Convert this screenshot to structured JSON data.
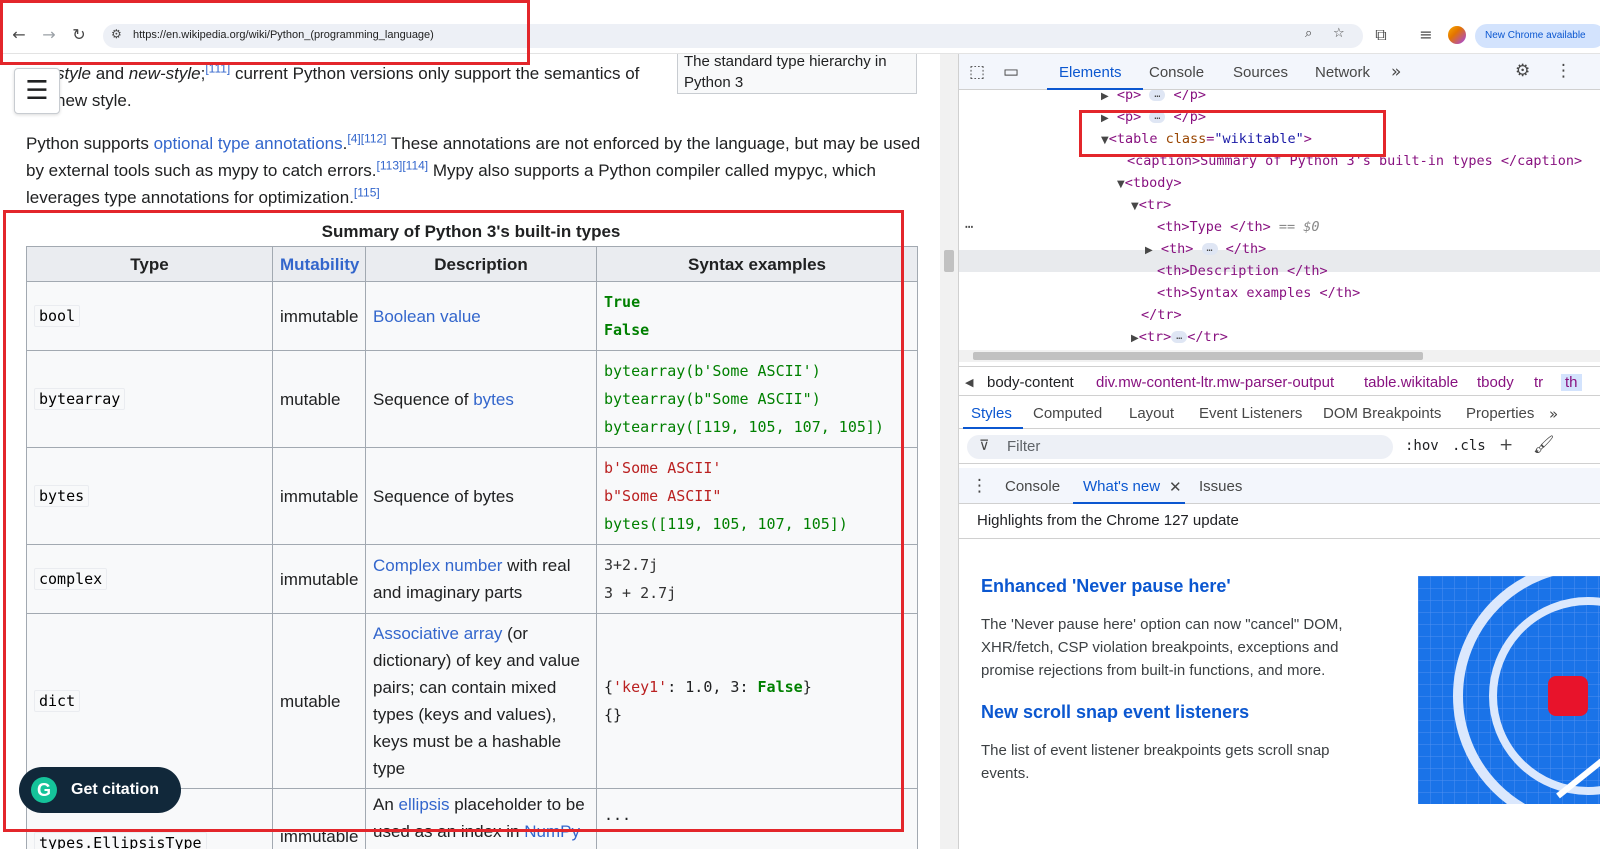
{
  "browser": {
    "url": "https://en.wikipedia.org/wiki/Python_(programming_language)",
    "new_chrome": "New Chrome available"
  },
  "wiki": {
    "para1_pre_a": "",
    "para1_style": "style",
    "para1_and": " and ",
    "para1_newstyle": "new-style",
    "para1_semicolon": ";",
    "para1_ref": "[111]",
    "para1_rest": " current Python versions only support the semantics of",
    "para1_line2": "new style.",
    "thumb_line1": "The standard type hierarchy in",
    "thumb_line2": "Python 3",
    "para2_pre": "Python supports ",
    "para2_link": "optional type annotations",
    "para2_ref1": "[4][112]",
    "para2_mid": " These annotations are not enforced by the language, but may be used by external tools such as mypy to catch errors.",
    "para2_ref2": "[113][114]",
    "para2_mid2": " Mypy also supports a Python compiler called mypyc, which leverages type annotations for optimization.",
    "para2_ref3": "[115]",
    "table": {
      "caption": "Summary of Python 3's built-in types",
      "headers": {
        "type": "Type",
        "mutability": "Mutability",
        "description": "Description",
        "syntax": "Syntax examples"
      },
      "rows": [
        {
          "type": "bool",
          "mutability": "immutable",
          "desc_link": "Boolean value",
          "syntax": [
            "True",
            "False"
          ]
        },
        {
          "type": "bytearray",
          "mutability": "mutable",
          "desc_pre": "Sequence of ",
          "desc_link": "bytes",
          "syntax": [
            "bytearray(b'Some ASCII')",
            "bytearray(b\"Some ASCII\")",
            "bytearray([119, 105, 107, 105])"
          ]
        },
        {
          "type": "bytes",
          "mutability": "immutable",
          "desc": "Sequence of bytes",
          "syntax": [
            "b'Some ASCII'",
            "b\"Some ASCII\"",
            "bytes([119, 105, 107, 105])"
          ]
        },
        {
          "type": "complex",
          "mutability": "immutable",
          "desc_link": "Complex number",
          "desc_post": " with real and imaginary parts",
          "syntax": [
            "3+2.7j",
            "3 + 2.7j"
          ]
        },
        {
          "type": "dict",
          "mutability": "mutable",
          "desc_link": "Associative array",
          "desc_post": " (or dictionary) of key and value pairs; can contain mixed types (keys and values), keys must be a hashable type",
          "syntax": [
            "{'key1': 1.0, 3: False}",
            "{}"
          ]
        },
        {
          "type": "types.EllipsisType",
          "mutability": "immutable",
          "desc_pre": "An ",
          "desc_link": "ellipsis",
          "desc_post": " placeholder to be used as an index in ",
          "desc_link2": "NumPy",
          "syntax": [
            "..."
          ]
        }
      ]
    },
    "citation": "Get citation"
  },
  "devtools": {
    "tabs": [
      "Elements",
      "Console",
      "Sources",
      "Network"
    ],
    "dom": {
      "p1": "<p>",
      "p1_close": "</p>",
      "table_open": "<table ",
      "table_attr": "class",
      "table_val": "\"wikitable\"",
      "caption": "<caption>Summary of Python 3's built-in types </caption>",
      "tbody": "<tbody>",
      "tr": "<tr>",
      "th_type": "<th>Type </th>",
      "th_type_eq": " == $0",
      "th_collapsed": "<th>",
      "th_close": "</th>",
      "th_desc": "<th>Description </th>",
      "th_syntax": "<th>Syntax examples </th>",
      "tr_close": "</tr>",
      "tr_collapsed": "<tr>",
      "tr_collapsed_close": "</tr>"
    },
    "breadcrumbs": [
      "body-content",
      "div.mw-content-ltr.mw-parser-output",
      "table.wikitable",
      "tbody",
      "tr",
      "th"
    ],
    "styles_tabs": [
      "Styles",
      "Computed",
      "Layout",
      "Event Listeners",
      "DOM Breakpoints",
      "Properties"
    ],
    "filter_placeholder": "Filter",
    "hov": ":hov",
    "cls": ".cls",
    "drawer_tabs": [
      "Console",
      "What's new",
      "Issues"
    ],
    "highlights": "Highlights from the Chrome 127 update",
    "whats_new": [
      {
        "title": "Enhanced 'Never pause here'",
        "text": "The 'Never pause here' option can now \"cancel\" DOM, XHR/fetch, CSP violation breakpoints, exceptions and promise rejections from built-in functions, and more."
      },
      {
        "title": "New scroll snap event listeners",
        "text": "The list of event listener breakpoints gets scroll snap events."
      }
    ]
  },
  "colors": {
    "link": "#3366cc",
    "devtools_accent": "#0b57d0",
    "annotation_red": "#e3262b"
  }
}
